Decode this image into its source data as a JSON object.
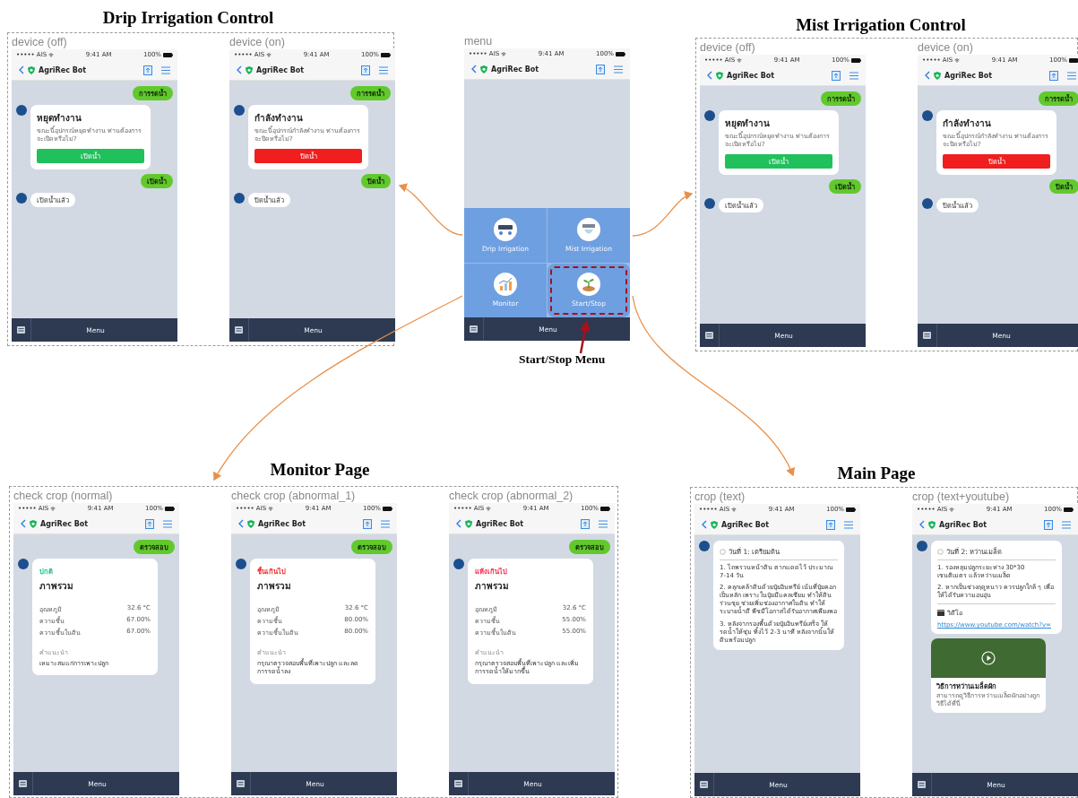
{
  "panels": [
    {
      "title": "Drip Irrigation Control",
      "phones": [
        {
          "label": "device (off)",
          "kind": "chat",
          "carrier": "••••• AIS",
          "time": "9:41 AM",
          "battery": "100%",
          "bot": "AgriRec Bot",
          "menu": "Menu",
          "messages": [
            {
              "kind": "user",
              "text": "การรดน้ำ"
            },
            {
              "kind": "card",
              "title": "หยุดทำงาน",
              "text": "ขณะนี้อุปกรณ์หยุดทำงาน ท่านต้องการจะเปิดหรือไม่?",
              "button": "เปิดน้ำ",
              "color": "#20c05c"
            },
            {
              "kind": "user",
              "text": "เปิดน้ำ"
            },
            {
              "kind": "bot",
              "text": "เปิดน้ำแล้ว"
            }
          ]
        },
        {
          "label": "device (on)",
          "kind": "chat",
          "carrier": "••••• AIS",
          "time": "9:41 AM",
          "battery": "100%",
          "bot": "AgriRec Bot",
          "menu": "Menu",
          "messages": [
            {
              "kind": "user",
              "text": "การรดน้ำ"
            },
            {
              "kind": "card",
              "title": "กำลังทำงาน",
              "text": "ขณะนี้อุปกรณ์กำลังทำงาน ท่านต้องการจะปิดหรือไม่?",
              "button": "ปิดน้ำ",
              "color": "#f01e1e"
            },
            {
              "kind": "user",
              "text": "ปิดน้ำ"
            },
            {
              "kind": "bot",
              "text": "ปิดน้ำแล้ว"
            }
          ]
        }
      ]
    },
    {
      "phones": [
        {
          "label": "menu",
          "kind": "menu",
          "carrier": "••••• AIS",
          "time": "9:41 AM",
          "battery": "100%",
          "bot": "AgriRec Bot",
          "menu": "Menu",
          "tiles": [
            {
              "label": "Drip Irrigation",
              "highlighted": false
            },
            {
              "label": "Mist Irrigation",
              "highlighted": false
            },
            {
              "label": "Monitor",
              "highlighted": false
            },
            {
              "label": "Start/Stop",
              "highlighted": true
            }
          ]
        }
      ],
      "annotation": "Start/Stop Menu"
    },
    {
      "title": "Mist Irrigation Control",
      "phones": [
        {
          "label": "device (off)",
          "kind": "chat",
          "carrier": "••••• AIS",
          "time": "9:41 AM",
          "battery": "100%",
          "bot": "AgriRec Bot",
          "menu": "Menu",
          "messages": [
            {
              "kind": "user",
              "text": "การรดน้ำ"
            },
            {
              "kind": "card",
              "title": "หยุดทำงาน",
              "text": "ขณะนี้อุปกรณ์หยุดทำงาน ท่านต้องการจะเปิดหรือไม่?",
              "button": "เปิดน้ำ",
              "color": "#20c05c"
            },
            {
              "kind": "user",
              "text": "เปิดน้ำ"
            },
            {
              "kind": "bot",
              "text": "เปิดน้ำแล้ว"
            }
          ]
        },
        {
          "label": "device (on)",
          "kind": "chat",
          "carrier": "••••• AIS",
          "time": "9:41 AM",
          "battery": "100%",
          "bot": "AgriRec Bot",
          "menu": "Menu",
          "messages": [
            {
              "kind": "user",
              "text": "การรดน้ำ"
            },
            {
              "kind": "card",
              "title": "กำลังทำงาน",
              "text": "ขณะนี้อุปกรณ์กำลังทำงาน ท่านต้องการจะปิดหรือไม่?",
              "button": "ปิดน้ำ",
              "color": "#f01e1e"
            },
            {
              "kind": "user",
              "text": "ปิดน้ำ"
            },
            {
              "kind": "bot",
              "text": "ปิดน้ำแล้ว"
            }
          ]
        }
      ]
    },
    {
      "title": "Monitor Page",
      "phones": [
        {
          "label": "check crop (normal)",
          "kind": "chat",
          "carrier": "••••• AIS",
          "time": "9:41 AM",
          "battery": "100%",
          "bot": "AgriRec Bot",
          "menu": "Menu",
          "messages": [
            {
              "kind": "user",
              "text": "ตรวจสอบ"
            },
            {
              "kind": "report",
              "status": "ปกติ",
              "color": "#1cc08a",
              "title": "ภาพรวม",
              "rows": [
                {
                  "label": "อุณหภูมิ",
                  "value": "32.6 °C"
                },
                {
                  "label": "ความชื้น",
                  "value": "67.00%"
                },
                {
                  "label": "ความชื้นในดิน",
                  "value": "67.00%"
                }
              ],
              "note_label": "คำแนะนำ",
              "note": "เหมาะสมแก่การเพาะปลูก"
            }
          ]
        },
        {
          "label": "check crop (abnormal_1)",
          "kind": "chat",
          "carrier": "••••• AIS",
          "time": "9:41 AM",
          "battery": "100%",
          "bot": "AgriRec Bot",
          "menu": "Menu",
          "messages": [
            {
              "kind": "user",
              "text": "ตรวจสอบ"
            },
            {
              "kind": "report",
              "status": "ชื้นเกินไป",
              "color": "#f02828",
              "title": "ภาพรวม",
              "rows": [
                {
                  "label": "อุณหภูมิ",
                  "value": "32.6 °C"
                },
                {
                  "label": "ความชื้น",
                  "value": "80.00%"
                },
                {
                  "label": "ความชื้นในดิน",
                  "value": "80.00%"
                }
              ],
              "note_label": "คำแนะนำ",
              "note": "กรุณาตรวจสอบพื้นที่เพาะปลูก และลดการรดน้ำลง"
            }
          ]
        },
        {
          "label": "check crop (abnormal_2)",
          "kind": "chat",
          "carrier": "••••• AIS",
          "time": "9:41 AM",
          "battery": "100%",
          "bot": "AgriRec Bot",
          "menu": "Menu",
          "messages": [
            {
              "kind": "user",
              "text": "ตรวจสอบ"
            },
            {
              "kind": "report",
              "status": "แห้งเกินไป",
              "color": "#f02850",
              "title": "ภาพรวม",
              "rows": [
                {
                  "label": "อุณหภูมิ",
                  "value": "32.6 °C"
                },
                {
                  "label": "ความชื้น",
                  "value": "55.00%"
                },
                {
                  "label": "ความชื้นในดิน",
                  "value": "55.00%"
                }
              ],
              "note_label": "คำแนะนำ",
              "note": "กรุณาตรวจสอบพื้นที่เพาะปลูก และเพิ่มการรดน้ำให้มากขึ้น"
            }
          ]
        }
      ]
    },
    {
      "title": "Main Page",
      "phones": [
        {
          "label": "crop (text)",
          "kind": "chat",
          "carrier": "••••• AIS",
          "time": "9:41 AM",
          "battery": "100%",
          "bot": "AgriRec Bot",
          "menu": "Menu",
          "messages": [
            {
              "kind": "steps",
              "heading": "วันที่ 1: เตรียมดิน",
              "items": [
                "1. ไถพรวนหน้าดิน ตากแดดไว้ ประมาณ 7-14 วัน",
                "2. คลุกเคล้าดินด้วยปุ๋ยอินทรีย์ เน้นที่ปุ๋ยคอกเป็นหลัก เพราะในปุ๋ยมีแคลเซียม ทำให้ดินร่วนซุย ช่วยเพิ่มช่องอากาศในดิน ทำให้ระบายน้ำดี พืชมีโอกาสได้รับอากาศเพียงพอ",
                "3. หลังจากรองพื้นด้วยปุ๋ยอินทรีย์เสร็จ ให้รดน้ำให้ชุ่ม ทิ้งไว้ 2-3 นาที หลังจากนั้นให้ดินพร้อมปลูก"
              ]
            }
          ]
        },
        {
          "label": "crop (text+youtube)",
          "kind": "chat",
          "carrier": "••••• AIS",
          "time": "9:41 AM",
          "battery": "100%",
          "bot": "AgriRec Bot",
          "menu": "Menu",
          "messages": [
            {
              "kind": "steps",
              "heading": "วันที่ 2: หว่านเมล็ด",
              "items": [
                "1. รองหลุมปลูกระยะห่าง 30*30 เซนติเมตร แล้วหว่านเมล็ด",
                "2. หากเป็นช่วงฤดูหนาว ควรปลูกใกล้ ๆ เพื่อให้ได้รับความอบอุ่น"
              ],
              "video_label": "วิดีโอ",
              "link": "https://www.youtube.com/watch?v="
            },
            {
              "kind": "video",
              "title": "วิธีการหว่านเมล็ดผัก",
              "text": "สามารถดูวิธีการหว่านเมล็ดผักอย่างถูกวิธีได้ที่นี่"
            }
          ]
        }
      ]
    }
  ]
}
